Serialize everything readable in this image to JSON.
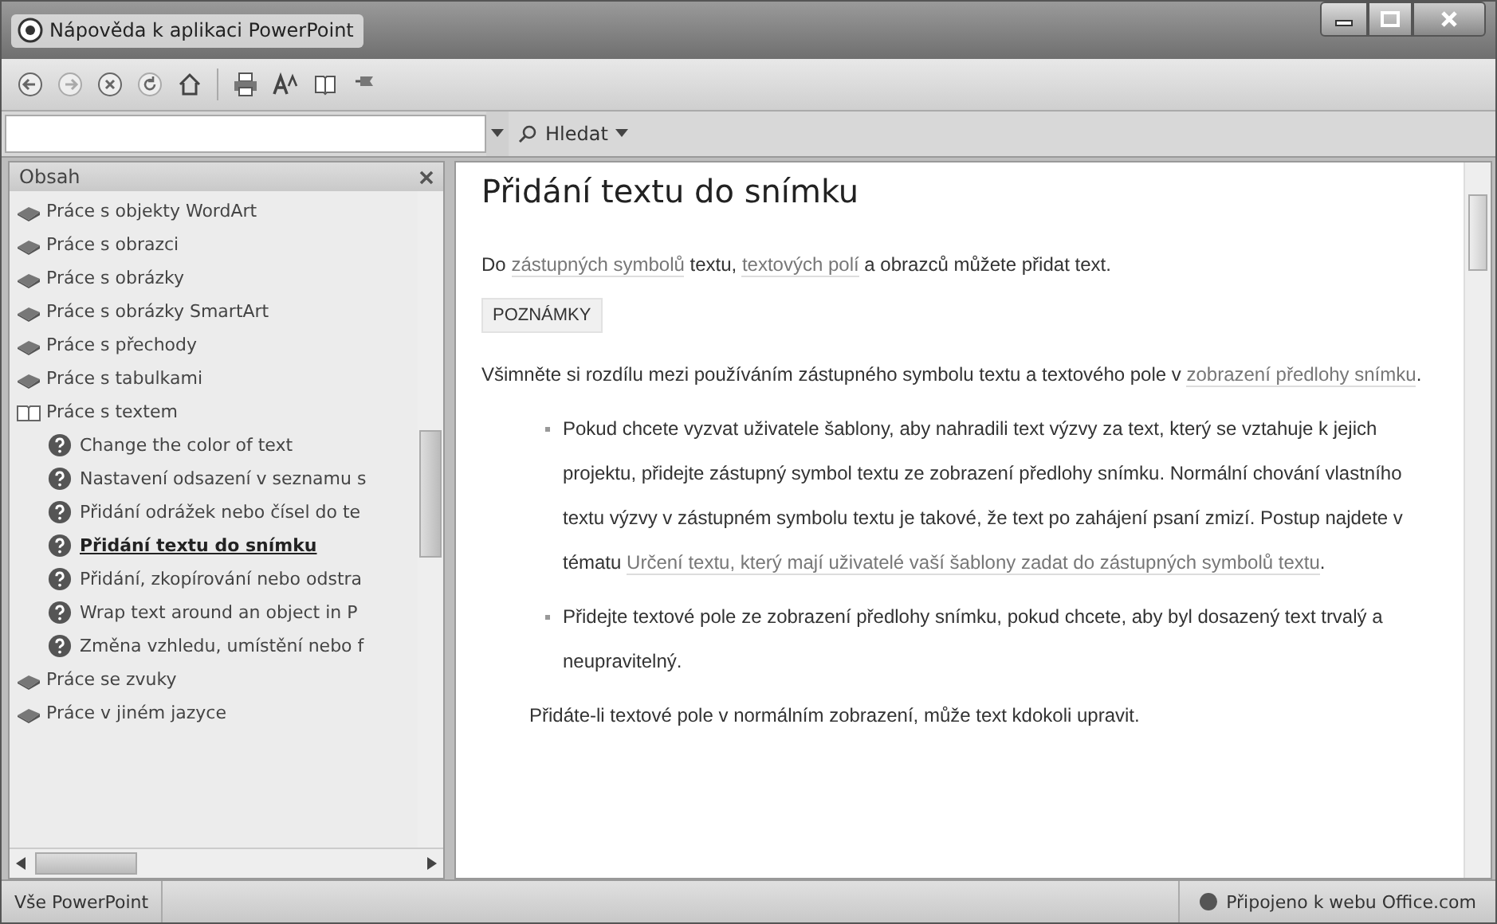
{
  "window": {
    "title": "Nápověda k aplikaci PowerPoint"
  },
  "search": {
    "button": "Hledat"
  },
  "sidebar": {
    "title": "Obsah",
    "items": [
      {
        "label": "Práce s objekty WordArt",
        "kind": "book",
        "expanded": false,
        "selected": false
      },
      {
        "label": "Práce s obrazci",
        "kind": "book",
        "expanded": false,
        "selected": false
      },
      {
        "label": "Práce s obrázky",
        "kind": "book",
        "expanded": false,
        "selected": false
      },
      {
        "label": "Práce s obrázky SmartArt",
        "kind": "book",
        "expanded": false,
        "selected": false
      },
      {
        "label": "Práce s přechody",
        "kind": "book",
        "expanded": false,
        "selected": false
      },
      {
        "label": "Práce s tabulkami",
        "kind": "book",
        "expanded": false,
        "selected": false
      },
      {
        "label": "Práce s textem",
        "kind": "book",
        "expanded": true,
        "selected": false,
        "children": [
          {
            "label": "Change the color of text",
            "kind": "topic",
            "selected": false
          },
          {
            "label": "Nastavení odsazení v seznamu s",
            "kind": "topic",
            "selected": false
          },
          {
            "label": "Přidání odrážek nebo čísel do te",
            "kind": "topic",
            "selected": false
          },
          {
            "label": "Přidání textu do snímku",
            "kind": "topic",
            "selected": true
          },
          {
            "label": "Přidání, zkopírování nebo odstra",
            "kind": "topic",
            "selected": false
          },
          {
            "label": "Wrap text around an object in P",
            "kind": "topic",
            "selected": false
          },
          {
            "label": "Změna vzhledu, umístění nebo f",
            "kind": "topic",
            "selected": false
          }
        ]
      },
      {
        "label": "Práce se zvuky",
        "kind": "book",
        "expanded": false,
        "selected": false
      },
      {
        "label": "Práce v jiném jazyce",
        "kind": "book",
        "expanded": false,
        "selected": false
      }
    ]
  },
  "article": {
    "title": "Přidání textu do snímku",
    "blocks": [
      {
        "kind": "para",
        "parts": [
          {
            "text": "Do "
          },
          {
            "text": "zástupných symbolů",
            "link": true
          },
          {
            "text": " textu, "
          },
          {
            "text": "textových polí",
            "link": true
          },
          {
            "text": " a obrazců můžete přidat text."
          }
        ]
      },
      {
        "kind": "label",
        "parts": [
          {
            "text": "POZNÁMKY"
          }
        ]
      },
      {
        "kind": "para",
        "parts": [
          {
            "text": "Všimněte si rozdílu mezi používáním zástupného symbolu textu a textového pole v "
          },
          {
            "text": "zobrazení předlohy snímku",
            "link": true
          },
          {
            "text": "."
          }
        ]
      },
      {
        "kind": "bullet",
        "parts": [
          {
            "text": "Pokud chcete vyzvat uživatele šablony, aby nahradili text výzvy za text, který se vztahuje k jejich projektu, přidejte zástupný symbol textu ze zobrazení předlohy snímku. Normální chování vlastního textu výzvy v zástupném symbolu textu je takové, že text po zahájení psaní zmizí. Postup najdete v tématu "
          },
          {
            "text": "Určení textu, který mají uživatelé vaší šablony zadat do zástupných symbolů textu",
            "link": true
          },
          {
            "text": "."
          }
        ]
      },
      {
        "kind": "bullet",
        "parts": [
          {
            "text": "Přidejte textové pole ze zobrazení předlohy snímku, pokud chcete, aby byl dosazený text trvalý a neupravitelný."
          }
        ]
      },
      {
        "kind": "indent",
        "parts": [
          {
            "text": "Přidáte-li textové pole v normálním zobrazení, může text kdokoli upravit."
          }
        ]
      }
    ]
  },
  "status_bar": {
    "scope": "Vše PowerPoint",
    "connection": "Připojeno k webu Office.com"
  }
}
